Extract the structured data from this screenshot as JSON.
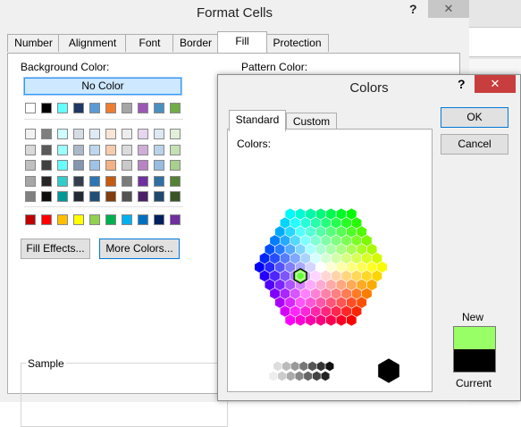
{
  "format_cells": {
    "title": "Format Cells",
    "help": "?",
    "close": "✕",
    "tabs": [
      "Number",
      "Alignment",
      "Font",
      "Border",
      "Fill",
      "Protection"
    ],
    "active_tab": "Fill",
    "background_color_label": "Background Color:",
    "pattern_color_label": "Pattern Color:",
    "no_color_label": "No Color",
    "theme_top_row": [
      "#ffffff",
      "#000000",
      "#66ffff",
      "#1f3864",
      "#5b9bd5",
      "#ed7d31",
      "#a5a5a5",
      "#9b59b6",
      "#4a90c0",
      "#70ad47"
    ],
    "theme_columns": [
      [
        "#f2f2f2",
        "#d9d9d9",
        "#bfbfbf",
        "#a6a6a6",
        "#808080"
      ],
      [
        "#7f7f7f",
        "#595959",
        "#404040",
        "#262626",
        "#0d0d0d"
      ],
      [
        "#ccffff",
        "#99ffff",
        "#66ffff",
        "#33cccc",
        "#009999"
      ],
      [
        "#d6dce4",
        "#acb9ca",
        "#8496b0",
        "#333f4f",
        "#222a35"
      ],
      [
        "#deebf6",
        "#bdd7ee",
        "#9dc3e6",
        "#2e75b5",
        "#1f4e79"
      ],
      [
        "#fbe5d5",
        "#f7cbac",
        "#f4b183",
        "#c55a11",
        "#833c0b"
      ],
      [
        "#ededed",
        "#dbdbdb",
        "#c9c9c9",
        "#7b7b7b",
        "#525252"
      ],
      [
        "#e7d6ef",
        "#d0add7",
        "#b884c3",
        "#7030a0",
        "#4b2066"
      ],
      [
        "#dce9f5",
        "#b9d3eb",
        "#96bde0",
        "#2f6fa5",
        "#1f4a6e"
      ],
      [
        "#e2efd9",
        "#c5e0b3",
        "#a8d08d",
        "#538135",
        "#375623"
      ]
    ],
    "standard_colors": [
      "#c00000",
      "#ff0000",
      "#ffc000",
      "#ffff00",
      "#92d050",
      "#00b050",
      "#00b0f0",
      "#0070c0",
      "#002060",
      "#7030a0"
    ],
    "fill_effects_button": "Fill Effects...",
    "more_colors_button": "More Colors...",
    "sample_label": "Sample"
  },
  "colors_dialog": {
    "title": "Colors",
    "help": "?",
    "close": "✕",
    "tabs": [
      "Standard",
      "Custom"
    ],
    "active_tab": "Standard",
    "colors_label": "Colors:",
    "ok_button": "OK",
    "cancel_button": "Cancel",
    "new_label": "New",
    "current_label": "Current",
    "new_color": "#99ff66",
    "current_color": "#000000",
    "selected_hex_color": "#66ff33"
  }
}
